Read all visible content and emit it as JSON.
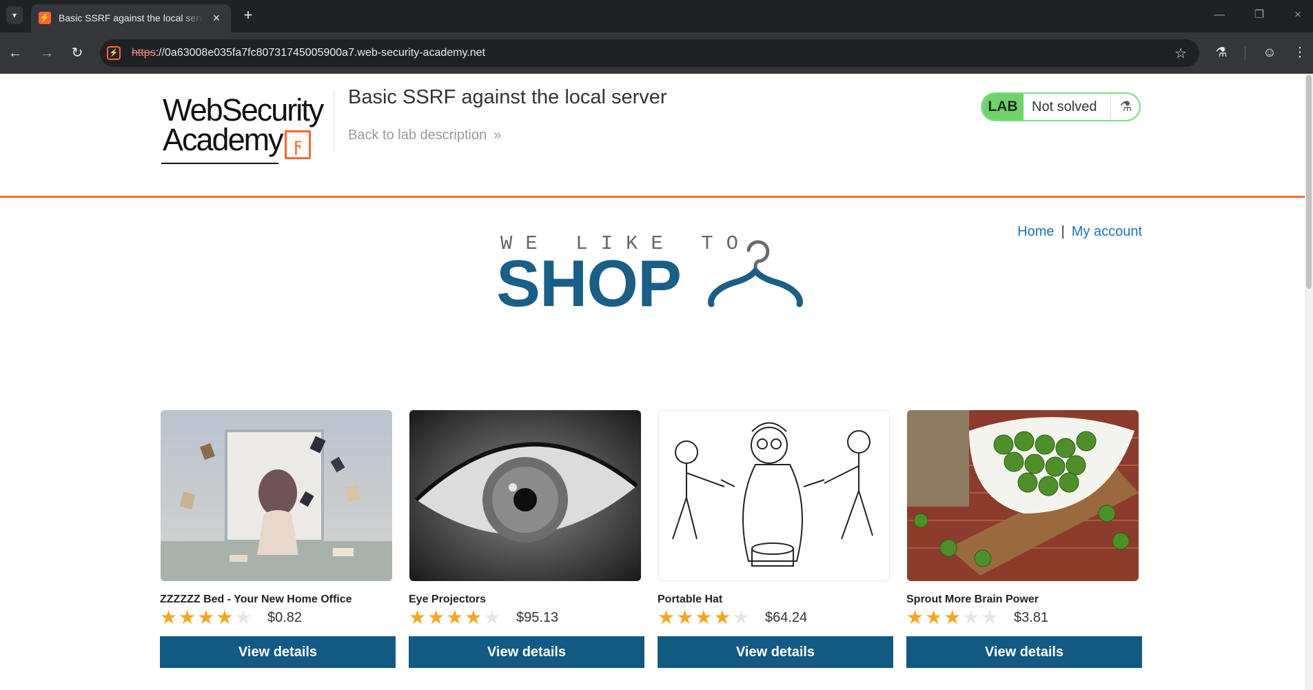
{
  "browser": {
    "tab_title": "Basic SSRF against the local server",
    "url_scheme": "https",
    "url_rest": "://0a63008e035fa7fc80731745005900a7.web-security-academy.net"
  },
  "header": {
    "logo_line1": "WebSecurity",
    "logo_line2": "Academy",
    "lab_title": "Basic SSRF against the local server",
    "back_link": "Back to lab description",
    "lab_badge": "LAB",
    "lab_status": "Not solved"
  },
  "nav": {
    "home": "Home",
    "separator": "|",
    "my_account": "My account"
  },
  "banner": {
    "tagline": "WE LIKE TO",
    "word": "SHOP"
  },
  "products": [
    {
      "name": "ZZZZZZ Bed - Your New Home Office",
      "rating": 4,
      "price": "$0.82",
      "button": "View details"
    },
    {
      "name": "Eye Projectors",
      "rating": 4,
      "price": "$95.13",
      "button": "View details"
    },
    {
      "name": "Portable Hat",
      "rating": 4,
      "price": "$64.24",
      "button": "View details"
    },
    {
      "name": "Sprout More Brain Power",
      "rating": 3,
      "price": "$3.81",
      "button": "View details"
    }
  ],
  "colors": {
    "accent": "#ff6633",
    "brand_blue": "#135a83",
    "link_blue": "#1a73b8",
    "lab_green": "#70d16d",
    "star": "#f5a623"
  }
}
